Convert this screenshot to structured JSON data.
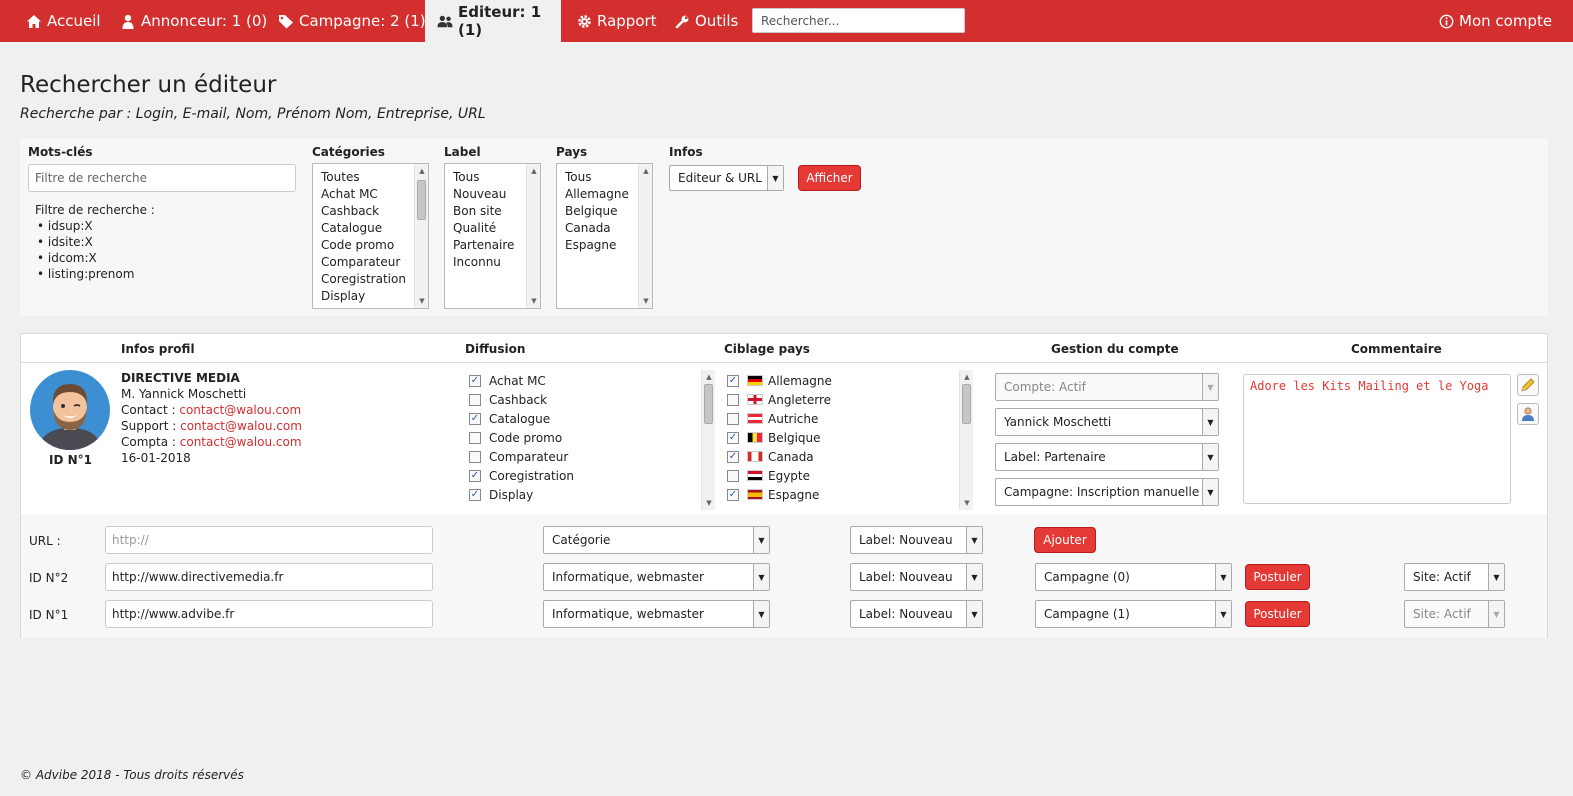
{
  "nav": {
    "home": "Accueil",
    "advertiser": "Annonceur: 1 (0)",
    "campaign": "Campagne: 2 (1)",
    "publisher": "Editeur: 1 (1)",
    "report": "Rapport",
    "tools": "Outils",
    "search_placeholder": "Rechercher...",
    "account": "Mon compte"
  },
  "page": {
    "title": "Rechercher un éditeur",
    "subtitle": "Recherche par : Login, E-mail, Nom, Prénom Nom, Entreprise, URL"
  },
  "filters": {
    "keywords_label": "Mots-clés",
    "keywords_placeholder": "Filtre de recherche",
    "help_title": "Filtre de recherche :",
    "help_items": [
      "idsup:X",
      "idsite:X",
      "idcom:X",
      "listing:prenom"
    ],
    "categories_label": "Catégories",
    "categories": [
      "Toutes",
      "Achat MC",
      "Cashback",
      "Catalogue",
      "Code promo",
      "Comparateur",
      "Coregistration",
      "Display"
    ],
    "label_label": "Label",
    "labels": [
      "Tous",
      "Nouveau",
      "Bon site",
      "Qualité",
      "Partenaire",
      "Inconnu"
    ],
    "country_label": "Pays",
    "countries": [
      "Tous",
      "Allemagne",
      "Belgique",
      "Canada",
      "Espagne"
    ],
    "info_label": "Infos",
    "info_value": "Editeur & URL",
    "show_button": "Afficher"
  },
  "table": {
    "headers": {
      "profile": "Infos profil",
      "diffusion": "Diffusion",
      "targeting": "Ciblage pays",
      "management": "Gestion du compte",
      "comment": "Commentaire"
    },
    "publisher": {
      "id": "ID N°1",
      "company": "DIRECTIVE MEDIA",
      "person": "M. Yannick Moschetti",
      "contact_label": "Contact : ",
      "contact": "contact@walou.com",
      "support_label": "Support : ",
      "support": "contact@walou.com",
      "billing_label": "Compta : ",
      "billing": "contact@walou.com",
      "date": "16-01-2018"
    },
    "diffusion": [
      {
        "label": "Achat MC",
        "checked": true
      },
      {
        "label": "Cashback",
        "checked": false
      },
      {
        "label": "Catalogue",
        "checked": true
      },
      {
        "label": "Code promo",
        "checked": false
      },
      {
        "label": "Comparateur",
        "checked": false
      },
      {
        "label": "Coregistration",
        "checked": true
      },
      {
        "label": "Display",
        "checked": true
      }
    ],
    "targeting": [
      {
        "label": "Allemagne",
        "checked": true
      },
      {
        "label": "Angleterre",
        "checked": false
      },
      {
        "label": "Autriche",
        "checked": false
      },
      {
        "label": "Belgique",
        "checked": true
      },
      {
        "label": "Canada",
        "checked": true
      },
      {
        "label": "Egypte",
        "checked": false
      },
      {
        "label": "Espagne",
        "checked": true
      }
    ],
    "management": {
      "account_status": "Compte: Actif",
      "manager": "Yannick Moschetti",
      "label": "Label: Partenaire",
      "campaign": "Campagne: Inscription manuelle"
    },
    "comment": "Adore les Kits Mailing et le Yoga"
  },
  "sites": {
    "url_label": "URL :",
    "url_placeholder": "http://",
    "category_placeholder": "Catégorie",
    "label_default": "Label: Nouveau",
    "add_button": "Ajouter",
    "apply_button": "Postuler",
    "rows": [
      {
        "id": "ID N°2",
        "url": "http://www.directivemedia.fr",
        "category": "Informatique, webmaster",
        "label": "Label: Nouveau",
        "campaign": "Campagne (0)",
        "status": "Site: Actif",
        "status_disabled": false
      },
      {
        "id": "ID N°1",
        "url": "http://www.advibe.fr",
        "category": "Informatique, webmaster",
        "label": "Label: Nouveau",
        "campaign": "Campagne (1)",
        "status": "Site: Actif",
        "status_disabled": true
      }
    ]
  },
  "footer": "© Advibe 2018 - Tous droits réservés",
  "colors": {
    "brand": "#d32f2f",
    "button": "#e53935"
  }
}
